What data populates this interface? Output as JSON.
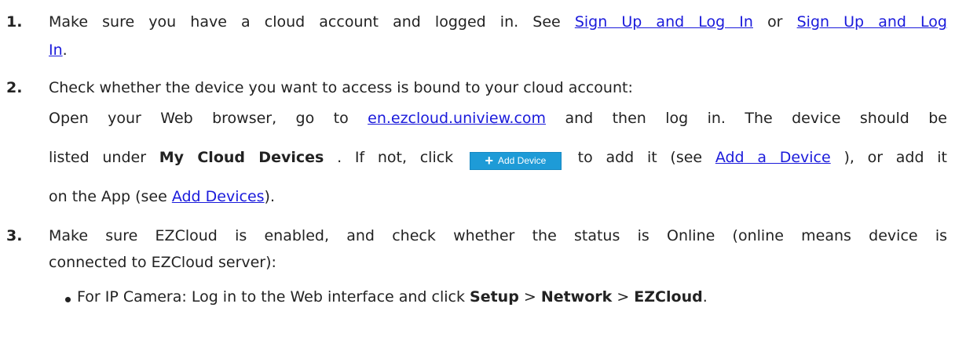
{
  "steps": [
    {
      "number": "1.",
      "text_a": "Make sure you have a cloud account and logged in. See ",
      "link_1": "Sign Up and Log In",
      "text_b": " or ",
      "link_2a": "Sign Up and Log",
      "link_2b": "In",
      "text_c": "."
    },
    {
      "number": "2.",
      "line1": "Check whether the device you want to access is bound to your cloud account:",
      "line2_a": " Open your Web browser, go to ",
      "line2_link": "en.ezcloud.uniview.com",
      "line2_b": " and then log in. The device should be",
      "line3_a": "listed under ",
      "line3_bold": "My Cloud Devices",
      "line3_b": ". If not, click",
      "add_button_label": "Add Device",
      "line3_c": "to add it (see ",
      "line3_link": "Add a Device",
      "line3_d": "), or add it",
      "line4_a": "on the App (see ",
      "line4_link": "Add Devices",
      "line4_b": ")."
    },
    {
      "number": "3.",
      "line1": "Make sure EZCloud is enabled, and check whether the status is Online (online means device is",
      "line2": "connected to EZCloud server):",
      "bullet_a": "For IP Camera: Log in to the Web interface and click ",
      "bullet_setup": "Setup",
      "bullet_sep1": " > ",
      "bullet_network": "Network",
      "bullet_sep2": " > ",
      "bullet_ezcloud": "EZCloud",
      "bullet_end": "."
    }
  ],
  "colors": {
    "link": "#1a1adb",
    "button_bg": "#1e9bd7",
    "text": "#222222"
  },
  "icons": {
    "add_button_icon": "plus-icon",
    "list_marker": "bullet-icon"
  }
}
